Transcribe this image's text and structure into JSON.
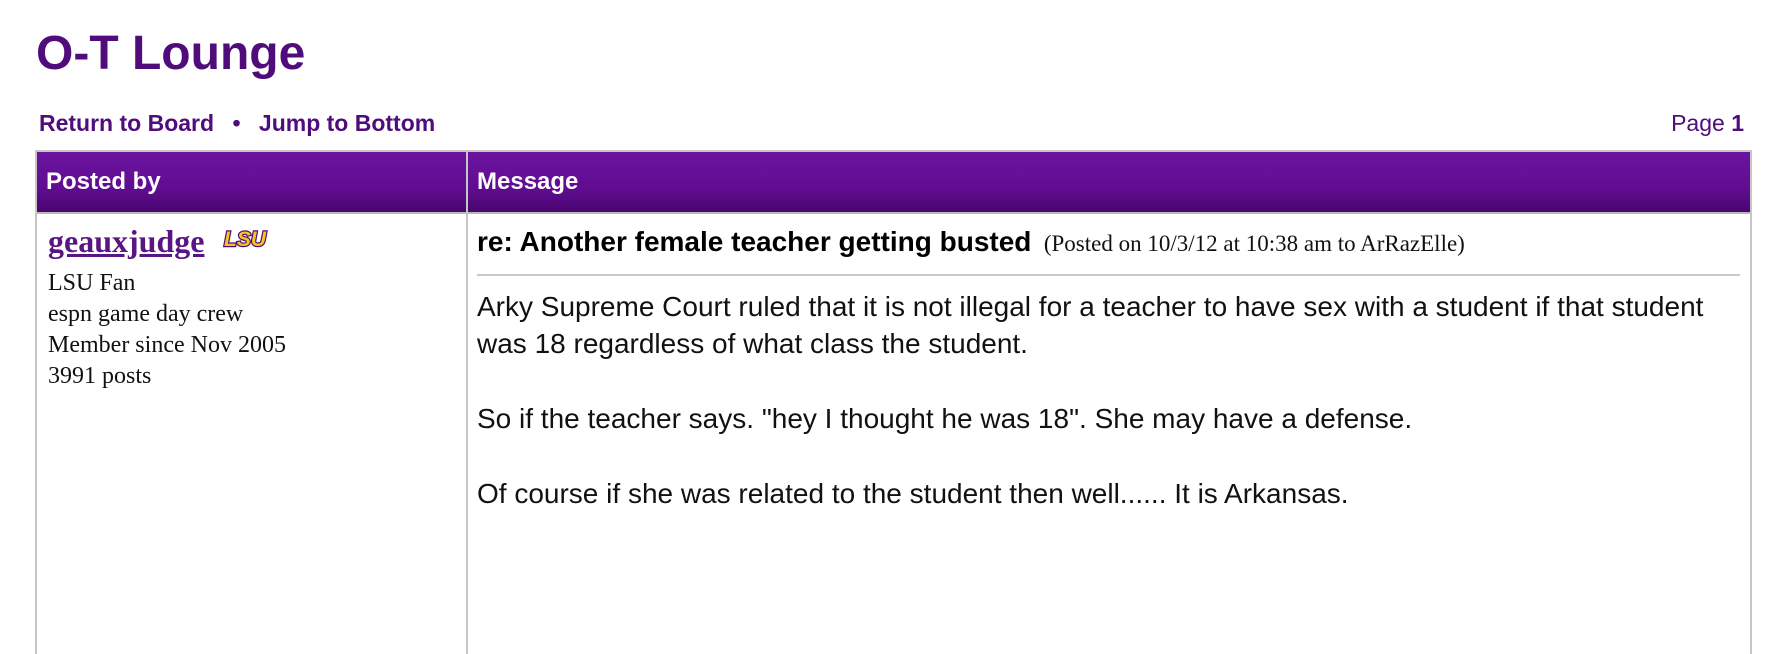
{
  "board": {
    "title": "O-T Lounge"
  },
  "nav": {
    "return_label": "Return to Board",
    "separator": "•",
    "jump_label": "Jump to Bottom",
    "page_label": "Page",
    "page_number": "1"
  },
  "table": {
    "header_posted_by": "Posted by",
    "header_message": "Message"
  },
  "post": {
    "author": {
      "name": "geauxjudge",
      "team_badge": "LSU",
      "fan_of": "LSU Fan",
      "title": "espn game day crew",
      "member_since": "Member since Nov 2005",
      "posts": "3991 posts"
    },
    "subject": "re: Another female teacher getting busted",
    "meta": "(Posted on 10/3/12 at 10:38 am to ArRazElle)",
    "body": [
      "Arky Supreme Court ruled that it is not illegal for a teacher to have sex with a student if that student was 18 regardless of what class the student.",
      "So if the teacher says. \"hey I thought he was 18\". She may have a defense.",
      "Of course if she was related to the student then well...... It is Arkansas."
    ]
  },
  "colors": {
    "brand_purple": "#4f0c7a",
    "header_purple": "#6c13a0",
    "lsu_gold": "#f5c518"
  },
  "icons": {
    "team_logo": "lsu-logo-icon"
  }
}
